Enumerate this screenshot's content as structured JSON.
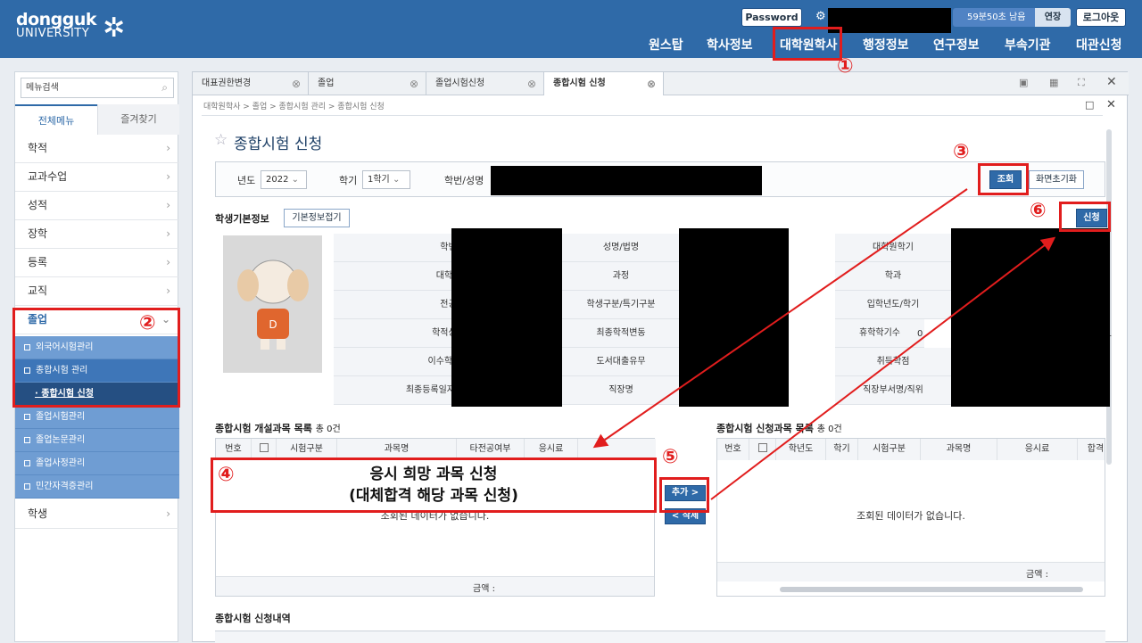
{
  "logo": {
    "line1": "dongguk",
    "line2": "UNIVERSITY"
  },
  "header": {
    "password": "Password",
    "timer": "59분50초 남음",
    "extend": "연장",
    "logout": "로그아웃",
    "nav": [
      "원스탑",
      "학사정보",
      "대학원학사",
      "행정정보",
      "연구정보",
      "부속기관",
      "대관신청"
    ]
  },
  "sidebar": {
    "search_placeholder": "메뉴검색",
    "tab_all": "전체메뉴",
    "tab_fav": "즐겨찾기",
    "items": [
      "학적",
      "교과수업",
      "성적",
      "장학",
      "등록",
      "교직",
      "졸업"
    ],
    "sub": [
      "외국어시험관리",
      "종합시험 관리",
      "· 종합시험 신청",
      "졸업시험관리",
      "졸업논문관리",
      "졸업사정관리",
      "민간자격증관리"
    ],
    "last": "학생"
  },
  "tabs": [
    "대표권한변경",
    "졸업",
    "졸업시험신청",
    "종합시험 신청"
  ],
  "breadcrumb": "대학원학사 > 졸업 > 종합시험 관리 > 종합시험 신청",
  "page_title": "종합시험 신청",
  "cond": {
    "year_label": "년도",
    "year": "2022",
    "term_label": "학기",
    "term": "1학기",
    "id_label": "학번/성명",
    "search": "조회",
    "reset": "화면초기화"
  },
  "student": {
    "title": "학생기본정보",
    "fold": "기본정보접기",
    "apply": "신청",
    "labels1": [
      "학번",
      "대학원",
      "전공",
      "학적상태",
      "이수학기수",
      "최종등록일자/등록학기"
    ],
    "labels2": [
      "성명/법명",
      "과정",
      "학생구분/특기구분",
      "최종학적변동",
      "도서대출유무",
      "직장명"
    ],
    "labels3": [
      "대학원학기",
      "학과",
      "입학년도/학기",
      "휴학학기수",
      "취득학점",
      "직장부서명/직위"
    ],
    "val_leave": "0",
    "val_extra": "1"
  },
  "left_grid": {
    "title": "종합시험 개설과목 목록",
    "count": "총 0건",
    "cols": [
      "번호",
      "",
      "시험구분",
      "과목명",
      "타전공여부",
      "응시료"
    ],
    "empty": "조회된 데이터가 없습니다.",
    "sum": "금액 :"
  },
  "right_grid": {
    "title": "종합시험 신청과목 목록",
    "count": "총 0건",
    "cols": [
      "번호",
      "",
      "학년도",
      "학기",
      "시험구분",
      "과목명",
      "응시료",
      "합격"
    ],
    "empty": "조회된 데이터가 없습니다.",
    "sum": "금액 :"
  },
  "add": "추가 >",
  "del": "< 삭제",
  "overlay": {
    "line1": "응시 희망 과목 신청",
    "line2": "(대체합격 해당 과목 신청)"
  },
  "history_title": "종합시험 신청내역",
  "markers": [
    "①",
    "②",
    "③",
    "④",
    "⑤",
    "⑥"
  ]
}
